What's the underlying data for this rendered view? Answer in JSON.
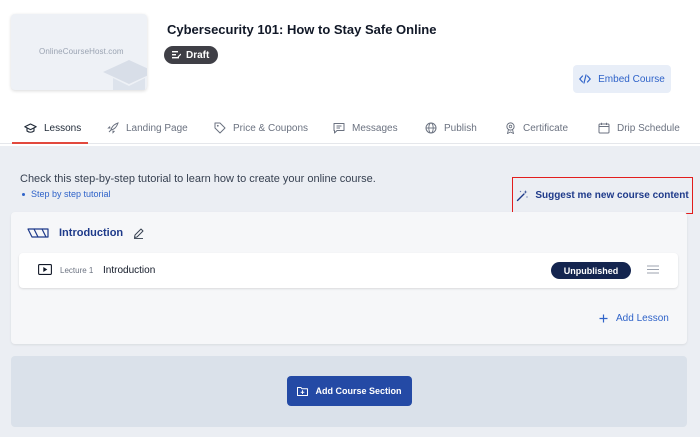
{
  "course": {
    "thumbnail_text": "OnlineCourseHost.com",
    "title": "Cybersecurity 101: How to Stay Safe Online",
    "status": "Draft",
    "embed_label": "Embed Course"
  },
  "tabs": [
    {
      "label": "Lessons",
      "icon": "graduation-cap-icon",
      "active": true
    },
    {
      "label": "Landing Page",
      "icon": "rocket-icon"
    },
    {
      "label": "Price & Coupons",
      "icon": "tag-icon"
    },
    {
      "label": "Messages",
      "icon": "message-icon"
    },
    {
      "label": "Publish",
      "icon": "globe-icon"
    },
    {
      "label": "Certificate",
      "icon": "certificate-icon"
    },
    {
      "label": "Drip Schedule",
      "icon": "calendar-icon"
    }
  ],
  "tutorial": {
    "text": "Check this step-by-step tutorial to learn how to create your online course.",
    "link_label": "Step by step tutorial"
  },
  "suggest": {
    "label": "Suggest me new course content",
    "icon": "magic-wand-icon"
  },
  "section": {
    "title": "Introduction",
    "lectures": [
      {
        "number": "Lecture 1",
        "title": "Introduction",
        "status": "Unpublished"
      }
    ],
    "add_lesson_label": "Add Lesson"
  },
  "add_section_label": "Add Course Section",
  "colors": {
    "accent": "#2f63c9",
    "tab_underline": "#e2483d",
    "dark_navy": "#14254f",
    "button_blue": "#244aa5",
    "highlight_box": "#e21d1d"
  }
}
